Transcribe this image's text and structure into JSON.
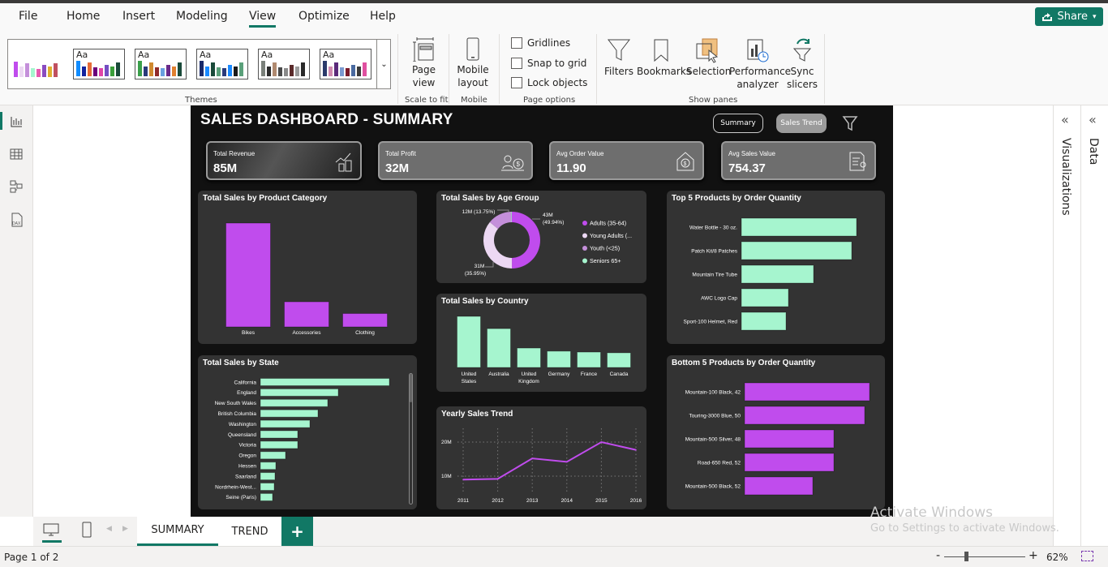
{
  "menu": {
    "items": [
      "File",
      "Home",
      "Insert",
      "Modeling",
      "View",
      "Optimize",
      "Help"
    ],
    "active": "View",
    "share_label": "Share"
  },
  "ribbon": {
    "themes_label": "Themes",
    "theme_sample_text": "Aa",
    "page_view": "Page view",
    "scale_to_fit": "Scale to fit",
    "mobile_layout": "Mobile layout",
    "mobile_group": "Mobile",
    "gridlines": "Gridlines",
    "snap_to_grid": "Snap to grid",
    "lock_objects": "Lock objects",
    "page_options": "Page options",
    "filters": "Filters",
    "bookmarks": "Bookmarks",
    "selection": "Selection",
    "performance_analyzer": "Performance analyzer",
    "sync_slicers": "Sync slicers",
    "show_panes": "Show panes"
  },
  "panes": {
    "visualizations": "Visualizations",
    "data": "Data"
  },
  "report": {
    "title": "SALES DASHBOARD - SUMMARY",
    "nav_summary": "Summary",
    "nav_sales_trend": "Sales Trend",
    "cards": [
      {
        "label": "Total Revenue",
        "value": "85M"
      },
      {
        "label": "Total Profit",
        "value": "32M"
      },
      {
        "label": "Avg Order Value",
        "value": "11.90"
      },
      {
        "label": "Avg Sales Value",
        "value": "754.37"
      }
    ]
  },
  "colors": {
    "purple": "#c04ced",
    "mint": "#a6f5cf",
    "panel": "#333333",
    "page": "#111111",
    "accent": "#117865"
  },
  "chart_data": [
    {
      "id": "category",
      "type": "bar",
      "title": "Total Sales by Product Category",
      "categories": [
        "Bikes",
        "Accessories",
        "Clothing"
      ],
      "values": [
        62,
        15,
        8
      ],
      "color": "#c04ced"
    },
    {
      "id": "age",
      "type": "pie",
      "title": "Total Sales by Age Group",
      "categories": [
        "Adults (35-64)",
        "Young Adults (...",
        "Youth (<25)",
        "Seniors 65+"
      ],
      "values": [
        49.94,
        35.95,
        13.75,
        0.36
      ],
      "data_labels": [
        [
          "43M",
          "(49.94%)"
        ],
        [
          "31M",
          "(35.95%)"
        ],
        [
          "12M (13.75%)"
        ]
      ],
      "colors": [
        "#c04ced",
        "#ecd8f3",
        "#c48fda",
        "#a6f5cf"
      ],
      "legend": "right"
    },
    {
      "id": "country",
      "type": "bar",
      "title": "Total Sales by Country",
      "categories": [
        [
          "United",
          "States"
        ],
        [
          "Australia"
        ],
        [
          "United",
          "Kingdom"
        ],
        [
          "Germany"
        ],
        [
          "France"
        ],
        [
          "Canada"
        ]
      ],
      "values": [
        27.9,
        21.2,
        10.6,
        8.9,
        8.4,
        8.0
      ],
      "color": "#a6f5cf"
    },
    {
      "id": "yearly",
      "type": "line",
      "title": "Yearly Sales Trend",
      "x": [
        "2011",
        "2012",
        "2013",
        "2014",
        "2015",
        "2016"
      ],
      "values": [
        9.0,
        9.2,
        15.2,
        14.2,
        20.0,
        17.7
      ],
      "yticks": [
        {
          "v": 10,
          "label": "10M"
        },
        {
          "v": 20,
          "label": "20M"
        }
      ],
      "ylim": [
        4,
        23
      ],
      "grid": true,
      "color": "#c04ced"
    },
    {
      "id": "top5",
      "type": "bar",
      "orientation": "horizontal",
      "title": "Top 5 Products by Order Quantity",
      "categories": [
        "Water Bottle - 30 oz.",
        "Patch Kit/8 Patches",
        "Mountain Tire Tube",
        "AWC Logo Cap",
        "Sport-100 Helmet, Red"
      ],
      "values": [
        142,
        136,
        89,
        58,
        55
      ],
      "color": "#a6f5cf"
    },
    {
      "id": "state",
      "type": "bar",
      "orientation": "horizontal",
      "title": "Total Sales by State",
      "categories": [
        "California",
        "England",
        "New South Wales",
        "British Columbia",
        "Washington",
        "Queensland",
        "Victoria",
        "Oregon",
        "Hessen",
        "Saarland",
        "Nordrhein-West...",
        "Seine (Paris)"
      ],
      "values": [
        159,
        96,
        83,
        71,
        61,
        46,
        46,
        31,
        19,
        18,
        17,
        15
      ],
      "color": "#a6f5cf"
    },
    {
      "id": "bottom5",
      "type": "bar",
      "orientation": "horizontal",
      "title": "Bottom 5 Products by Order Quantity",
      "categories": [
        "Mountain-100 Black, 42",
        "Touring-3000 Blue, 50",
        "Mountain-500 Silver, 48",
        "Road-650 Red, 52",
        "Mountain-500 Black, 52"
      ],
      "values": [
        154,
        148,
        110,
        110,
        84
      ],
      "color": "#c04ced"
    }
  ],
  "pages": {
    "tabs": [
      "SUMMARY",
      "TREND"
    ],
    "active": "SUMMARY",
    "add_label": "+"
  },
  "status": {
    "page_info": "Page 1 of 2",
    "zoom": "62%",
    "zoom_minus": "-",
    "zoom_plus": "+",
    "zoom_level": 62
  },
  "watermark": {
    "line1": "Activate Windows",
    "line2": "Go to Settings to activate Windows."
  }
}
